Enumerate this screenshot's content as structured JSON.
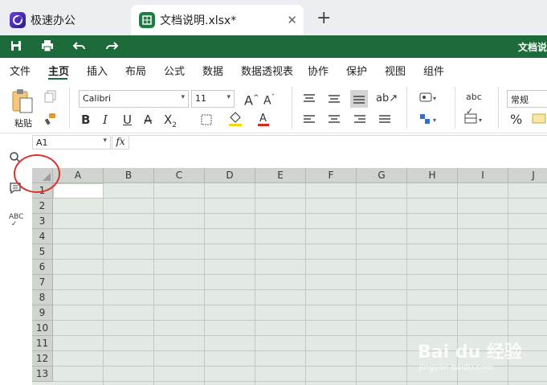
{
  "tabs": [
    {
      "label": "极速办公",
      "icon": "app-logo-icon"
    },
    {
      "label": "文档说明.xlsx*",
      "icon": "spreadsheet-icon",
      "close": "✕"
    }
  ],
  "new_tab": "+",
  "quick_toolbar": {
    "title": "文档说",
    "icons": [
      "save-icon",
      "print-icon",
      "undo-icon",
      "redo-icon"
    ]
  },
  "menu": [
    "文件",
    "主页",
    "插入",
    "布局",
    "公式",
    "数据",
    "数据透视表",
    "协作",
    "保护",
    "视图",
    "组件"
  ],
  "active_menu": "主页",
  "ribbon": {
    "paste_label": "粘贴",
    "font_name": "Calibri",
    "font_size": "11",
    "number_format": "常规",
    "bold": "B",
    "italic": "I",
    "underline": "U",
    "percent": "%"
  },
  "formula_bar": {
    "name_box": "A1",
    "fx": "fx",
    "content": ""
  },
  "grid": {
    "columns": [
      "A",
      "B",
      "C",
      "D",
      "E",
      "F",
      "G",
      "H",
      "I",
      "J"
    ],
    "rows": [
      "1",
      "2",
      "3",
      "4",
      "5",
      "6",
      "7",
      "8",
      "9",
      "10",
      "11",
      "12",
      "13"
    ]
  },
  "colors": {
    "brand_green": "#1d6b3a",
    "grid_bg": "#e3e9e3",
    "highlight_circle": "#d9332b"
  },
  "watermark": {
    "logo": "Bai du 经验",
    "url": "jingyan.baidu.com"
  }
}
